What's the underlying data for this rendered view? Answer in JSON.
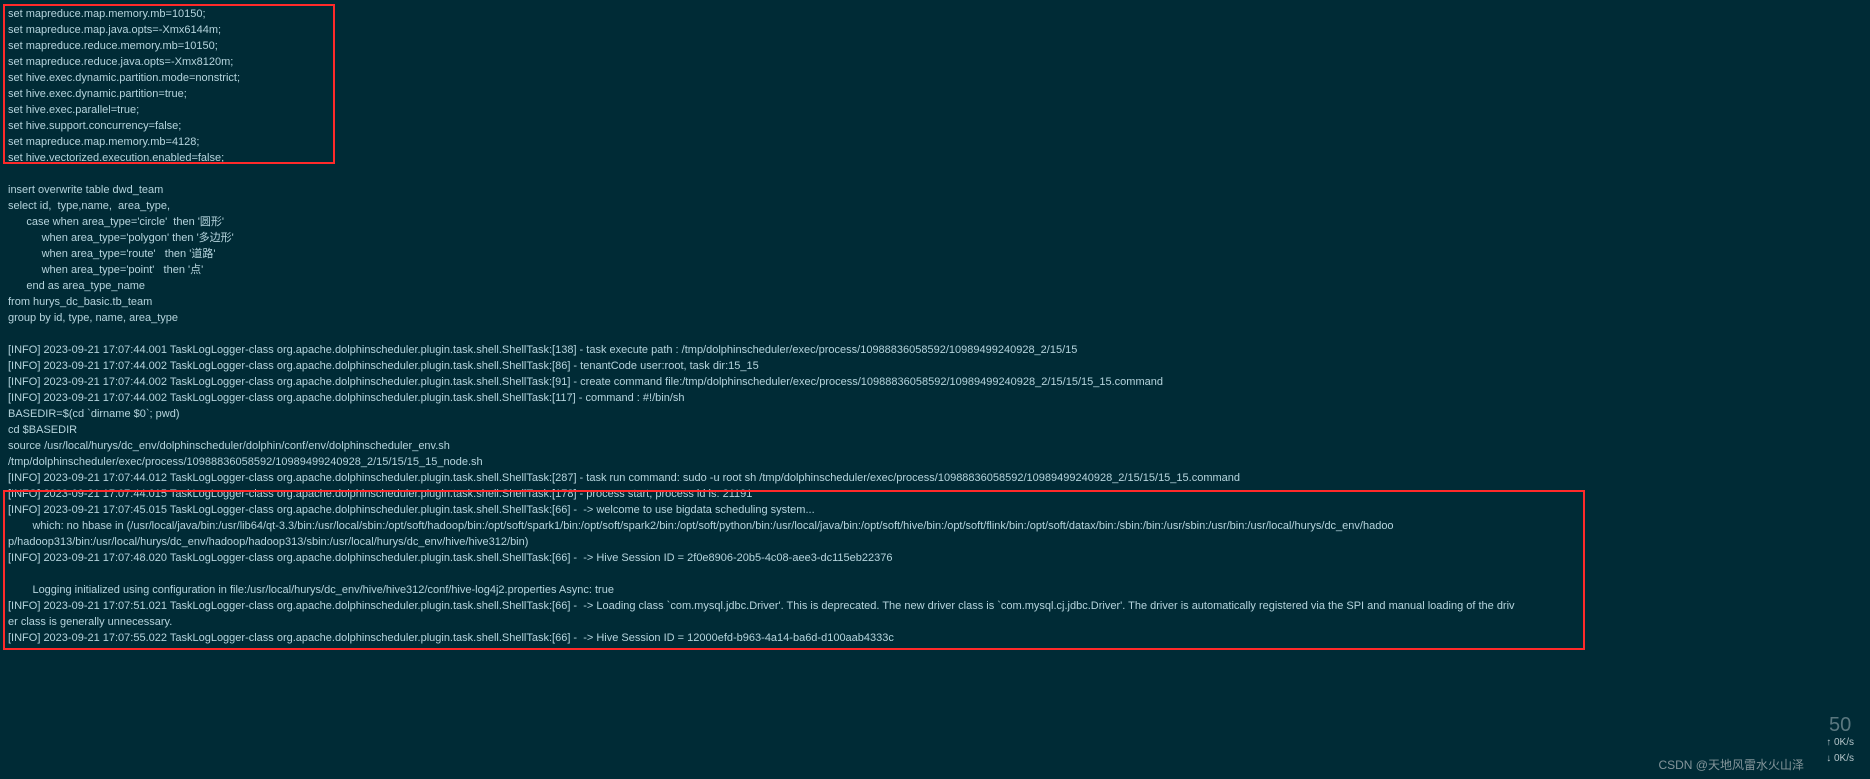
{
  "config_block": [
    "set mapreduce.map.memory.mb=10150;",
    "set mapreduce.map.java.opts=-Xmx6144m;",
    "set mapreduce.reduce.memory.mb=10150;",
    "set mapreduce.reduce.java.opts=-Xmx8120m;",
    "set hive.exec.dynamic.partition.mode=nonstrict;",
    "set hive.exec.dynamic.partition=true;",
    "set hive.exec.parallel=true;",
    "set hive.support.concurrency=false;",
    "set mapreduce.map.memory.mb=4128;",
    "set hive.vectorized.execution.enabled=false;"
  ],
  "sql_block": [
    "",
    "insert overwrite table dwd_team",
    "select id,  type,name,  area_type,",
    "      case when area_type='circle'  then '圆形'",
    "           when area_type='polygon' then '多边形'",
    "           when area_type='route'   then '道路'",
    "           when area_type='point'   then '点'",
    "      end as area_type_name",
    "from hurys_dc_basic.tb_team",
    "group by id, type, name, area_type",
    ""
  ],
  "log_block": [
    "[INFO] 2023-09-21 17:07:44.001 TaskLogLogger-class org.apache.dolphinscheduler.plugin.task.shell.ShellTask:[138] - task execute path : /tmp/dolphinscheduler/exec/process/10988836058592/10989499240928_2/15/15",
    "[INFO] 2023-09-21 17:07:44.002 TaskLogLogger-class org.apache.dolphinscheduler.plugin.task.shell.ShellTask:[86] - tenantCode user:root, task dir:15_15",
    "[INFO] 2023-09-21 17:07:44.002 TaskLogLogger-class org.apache.dolphinscheduler.plugin.task.shell.ShellTask:[91] - create command file:/tmp/dolphinscheduler/exec/process/10988836058592/10989499240928_2/15/15/15_15.command",
    "[INFO] 2023-09-21 17:07:44.002 TaskLogLogger-class org.apache.dolphinscheduler.plugin.task.shell.ShellTask:[117] - command : #!/bin/sh",
    "BASEDIR=$(cd `dirname $0`; pwd)",
    "cd $BASEDIR",
    "source /usr/local/hurys/dc_env/dolphinscheduler/dolphin/conf/env/dolphinscheduler_env.sh",
    "/tmp/dolphinscheduler/exec/process/10988836058592/10989499240928_2/15/15/15_15_node.sh",
    "[INFO] 2023-09-21 17:07:44.012 TaskLogLogger-class org.apache.dolphinscheduler.plugin.task.shell.ShellTask:[287] - task run command: sudo -u root sh /tmp/dolphinscheduler/exec/process/10988836058592/10989499240928_2/15/15/15_15.command",
    "[INFO] 2023-09-21 17:07:44.015 TaskLogLogger-class org.apache.dolphinscheduler.plugin.task.shell.ShellTask:[178] - process start, process id is: 21191",
    "[INFO] 2023-09-21 17:07:45.015 TaskLogLogger-class org.apache.dolphinscheduler.plugin.task.shell.ShellTask:[66] -  -> welcome to use bigdata scheduling system...",
    "        which: no hbase in (/usr/local/java/bin:/usr/lib64/qt-3.3/bin:/usr/local/sbin:/opt/soft/hadoop/bin:/opt/soft/spark1/bin:/opt/soft/spark2/bin:/opt/soft/python/bin:/usr/local/java/bin:/opt/soft/hive/bin:/opt/soft/flink/bin:/opt/soft/datax/bin:/sbin:/bin:/usr/sbin:/usr/bin:/usr/local/hurys/dc_env/hadoo",
    "p/hadoop313/bin:/usr/local/hurys/dc_env/hadoop/hadoop313/sbin:/usr/local/hurys/dc_env/hive/hive312/bin)",
    "[INFO] 2023-09-21 17:07:48.020 TaskLogLogger-class org.apache.dolphinscheduler.plugin.task.shell.ShellTask:[66] -  -> Hive Session ID = 2f0e8906-20b5-4c08-aee3-dc115eb22376",
    "        ",
    "        Logging initialized using configuration in file:/usr/local/hurys/dc_env/hive/hive312/conf/hive-log4j2.properties Async: true",
    "[INFO] 2023-09-21 17:07:51.021 TaskLogLogger-class org.apache.dolphinscheduler.plugin.task.shell.ShellTask:[66] -  -> Loading class `com.mysql.jdbc.Driver'. This is deprecated. The new driver class is `com.mysql.cj.jdbc.Driver'. The driver is automatically registered via the SPI and manual loading of the driv",
    "er class is generally unnecessary.",
    "[INFO] 2023-09-21 17:07:55.022 TaskLogLogger-class org.apache.dolphinscheduler.plugin.task.shell.ShellTask:[66] -  -> Hive Session ID = 12000efd-b963-4a14-ba6d-d100aab4333c"
  ],
  "watermark": "CSDN @天地风雷水火山泽",
  "netspeed": {
    "big": "50",
    "up": "↑   0K/s",
    "down": "↓   0K/s"
  }
}
